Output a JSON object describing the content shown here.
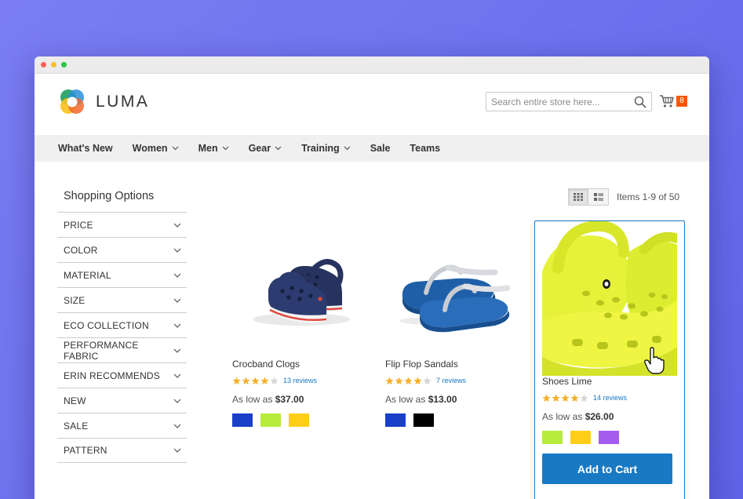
{
  "header": {
    "logo_text": "LUMA",
    "search": {
      "placeholder": "Search entire store here..."
    },
    "cart_count": "8"
  },
  "nav": [
    {
      "label": "What's New",
      "has_dropdown": false
    },
    {
      "label": "Women",
      "has_dropdown": true
    },
    {
      "label": "Men",
      "has_dropdown": true
    },
    {
      "label": "Gear",
      "has_dropdown": true
    },
    {
      "label": "Training",
      "has_dropdown": true
    },
    {
      "label": "Sale",
      "has_dropdown": false
    },
    {
      "label": "Teams",
      "has_dropdown": false
    }
  ],
  "sidebar": {
    "title": "Shopping Options",
    "filters": [
      "PRICE",
      "COLOR",
      "MATERIAL",
      "SIZE",
      "ECO COLLECTION",
      "PERFORMANCE FABRIC",
      "ERIN RECOMMENDS",
      "NEW",
      "SALE",
      "PATTERN"
    ]
  },
  "toolbar": {
    "amount": "Items 1-9 of 50",
    "modes": [
      "grid",
      "list"
    ],
    "active_mode": "grid"
  },
  "products": [
    {
      "name": "Crocband Clogs",
      "rating": 4,
      "reviews": "13 reviews",
      "price_prefix": "As low as",
      "price": "$37.00",
      "swatches": [
        "#1a3fc9",
        "#b6ec3d",
        "#ffce1a"
      ]
    },
    {
      "name": "Flip Flop Sandals",
      "rating": 4,
      "reviews": "7 reviews",
      "price_prefix": "As low as",
      "price": "$13.00",
      "swatches": [
        "#1a3fc9",
        "#000000"
      ]
    },
    {
      "name": "Shoes Lime",
      "rating": 4,
      "reviews": "14 reviews",
      "price_prefix": "As low as",
      "price": "$26.00",
      "swatches": [
        "#b6ec3d",
        "#ffce1a",
        "#a45cf0"
      ],
      "add_to_cart_label": "Add to Cart"
    }
  ],
  "colors": {
    "accent": "#1979c3",
    "badge": "#ff5501",
    "star": "#f6b12e",
    "background": "#6d71ee"
  }
}
